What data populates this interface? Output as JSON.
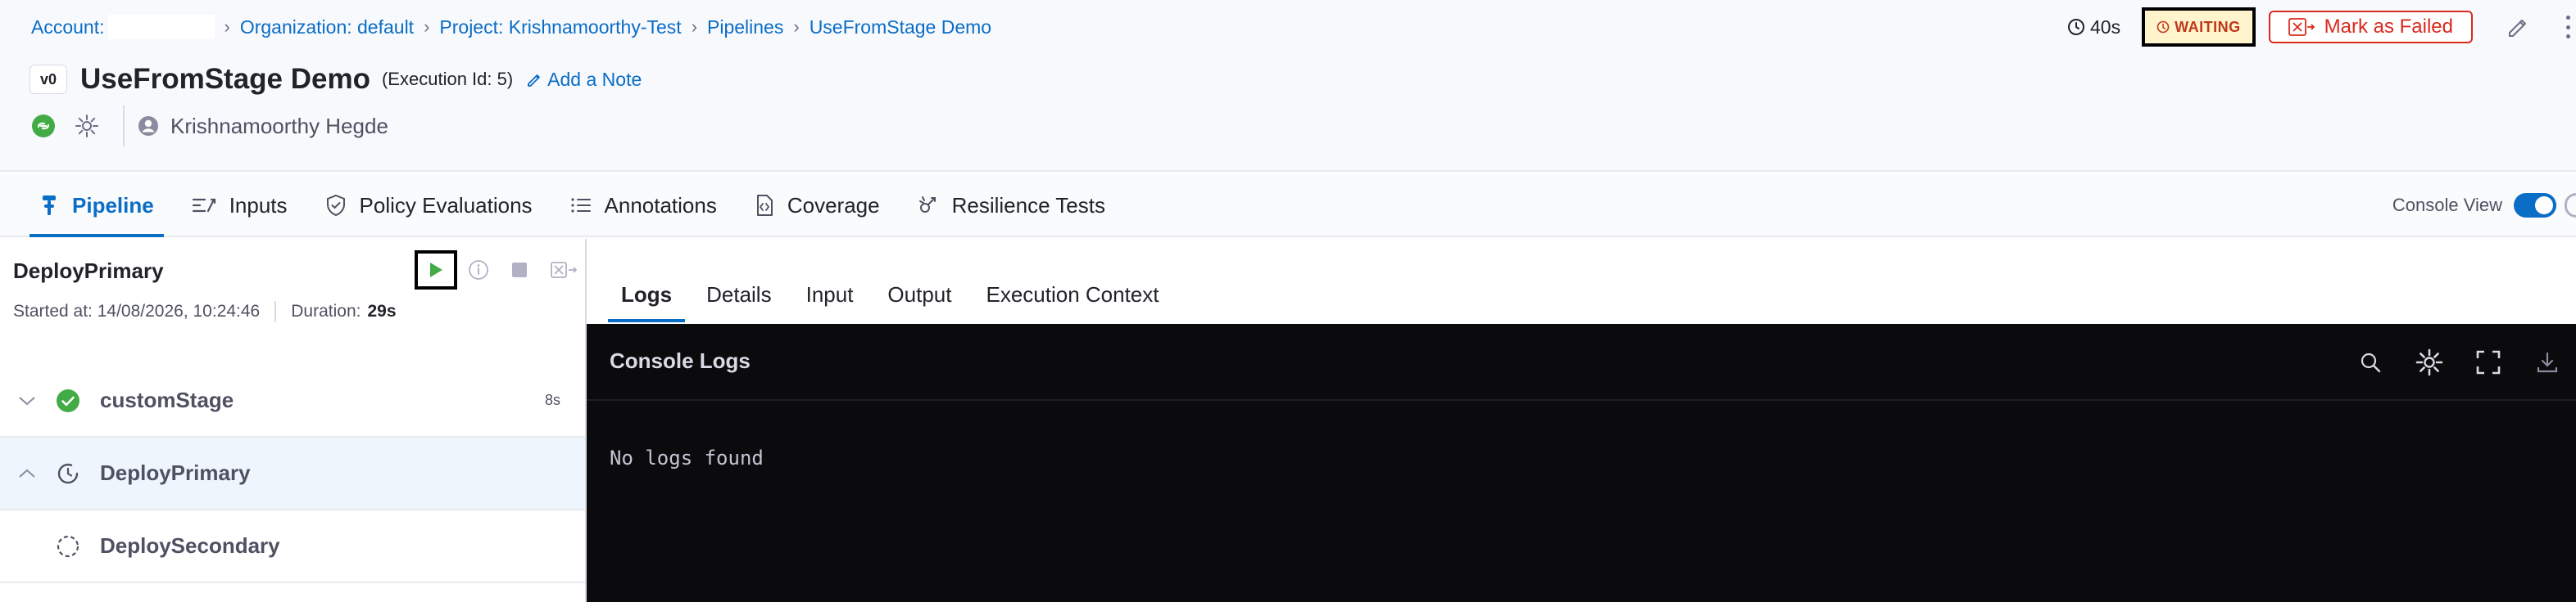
{
  "breadcrumb": {
    "account": "Account:",
    "organization": "Organization: default",
    "project": "Project: Krishnamoorthy-Test",
    "pipelines": "Pipelines",
    "pipeline": "UseFromStage Demo"
  },
  "header": {
    "version": "v0",
    "title": "UseFromStage Demo",
    "execution_id": "(Execution Id: 5)",
    "add_note": "Add a Note",
    "author": "Krishnamoorthy Hegde",
    "duration": "40s",
    "status": "WAITING",
    "mark_failed": "Mark as Failed"
  },
  "tabs": [
    {
      "label": "Pipeline",
      "icon": "pipeline-icon",
      "active": true
    },
    {
      "label": "Inputs",
      "icon": "inputs-icon"
    },
    {
      "label": "Policy Evaluations",
      "icon": "policy-icon"
    },
    {
      "label": "Annotations",
      "icon": "annotations-icon"
    },
    {
      "label": "Coverage",
      "icon": "coverage-icon"
    },
    {
      "label": "Resilience Tests",
      "icon": "resilience-icon"
    }
  ],
  "console_view": {
    "label": "Console View",
    "enabled": true
  },
  "stage_panel": {
    "title": "DeployPrimary",
    "started_label": "Started at: 14/08/2026, 10:24:46",
    "duration_label": "Duration:",
    "duration_value": "29s",
    "stages": [
      {
        "name": "customStage",
        "status": "success",
        "time": "8s",
        "expanded": false
      },
      {
        "name": "DeployPrimary",
        "status": "waiting",
        "time": "",
        "expanded": true,
        "selected": true
      },
      {
        "name": "DeploySecondary",
        "status": "not-started",
        "time": ""
      }
    ]
  },
  "details": {
    "subtabs": [
      "Logs",
      "Details",
      "Input",
      "Output",
      "Execution Context"
    ],
    "active_subtab": "Logs",
    "console_title": "Console Logs",
    "empty_text": "No logs found"
  },
  "colors": {
    "accent": "#0a6dc6",
    "success": "#42ab45",
    "danger": "#da291d",
    "waiting_bg": "#fff4cc"
  }
}
